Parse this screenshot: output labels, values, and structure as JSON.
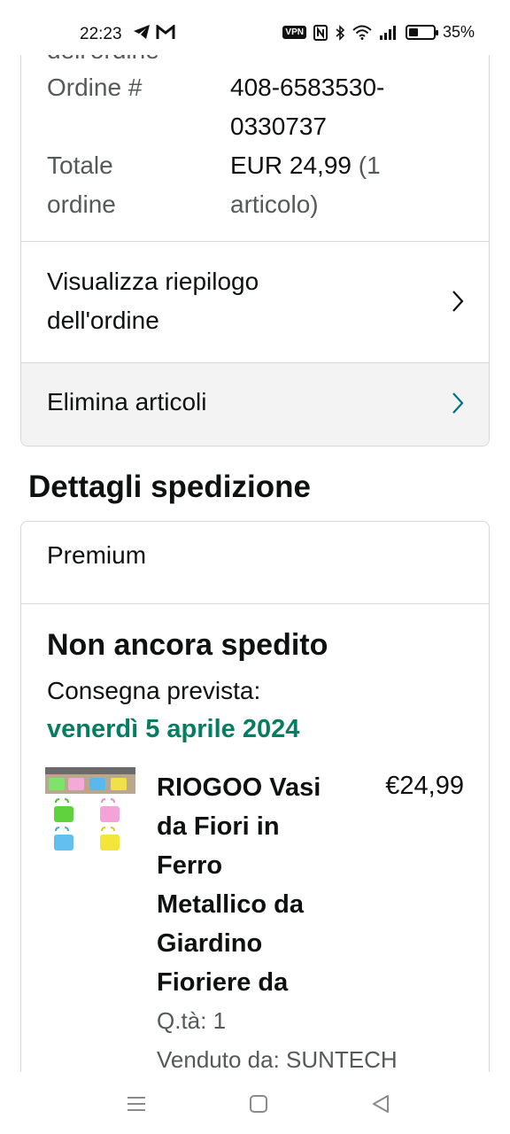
{
  "status_bar": {
    "time": "22:23",
    "left_icons": [
      "telegram-icon",
      "gmail-icon"
    ],
    "right_icons": [
      "vpn-icon",
      "nfc-icon",
      "bluetooth-icon",
      "wifi-icon",
      "signal-icon",
      "battery-icon"
    ],
    "vpn_label": "VPN",
    "battery_percent": "35%"
  },
  "order_summary": {
    "cut_label": "dell'ordine",
    "order_number_label": "Ordine #",
    "order_number_line1": "408-6583530-",
    "order_number_line2": "0330737",
    "total_label_line1": "Totale",
    "total_label_line2": "ordine",
    "total_value_main": "EUR 24,99",
    "total_value_paren1": "(1",
    "total_value_paren2": "articolo)",
    "view_summary_line1": "Visualizza riepilogo",
    "view_summary_line2": "dell'ordine",
    "delete_items_label": "Elimina articoli"
  },
  "shipping": {
    "section_title": "Dettagli spedizione",
    "shipping_type": "Premium",
    "status": "Non ancora spedito",
    "eta_label": "Consegna prevista:",
    "eta_date": "venerdì 5 aprile 2024",
    "product": {
      "title_lines": [
        "RIOGOO Vasi",
        "da Fiori in",
        "Ferro",
        "Metallico da",
        "Giardino",
        "Fioriere da"
      ],
      "price": "€24,99",
      "quantity": "Q.tà: 1",
      "seller": "Venduto da: SUNTECH"
    }
  },
  "colors": {
    "eta_green": "#067d62",
    "text_primary": "#0f1111",
    "text_secondary": "#565959",
    "border": "#d5d9d9",
    "chevron_teal": "#007185"
  },
  "nav_bar": {
    "buttons": [
      "menu-icon",
      "home-icon",
      "back-icon"
    ]
  }
}
